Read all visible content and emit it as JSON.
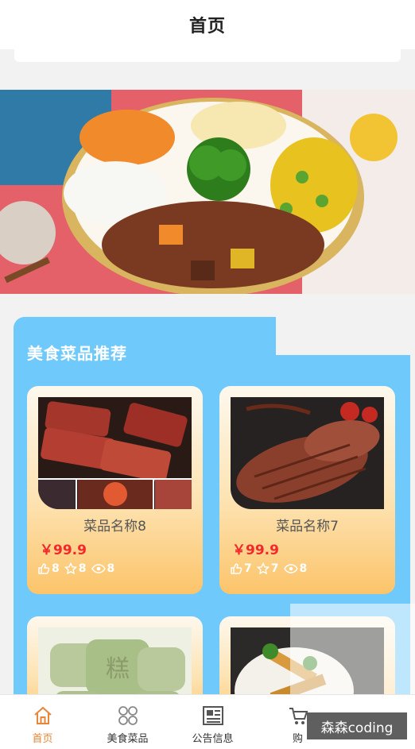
{
  "header": {
    "title": "首页"
  },
  "recommend": {
    "title": "美食菜品推荐",
    "items": [
      {
        "name": "菜品名称8",
        "price": "￥99.9",
        "likes": "8",
        "favorites": "8",
        "views": "8"
      },
      {
        "name": "菜品名称7",
        "price": "￥99.9",
        "likes": "7",
        "favorites": "7",
        "views": "8"
      }
    ]
  },
  "tabbar": {
    "items": [
      {
        "label": "首页",
        "icon": "home-icon",
        "active": true
      },
      {
        "label": "美食菜品",
        "icon": "grid-icon"
      },
      {
        "label": "公告信息",
        "icon": "news-icon"
      },
      {
        "label": "购",
        "icon": "cart-icon"
      }
    ]
  },
  "watermark": "森森coding",
  "colors": {
    "accent": "#e8863a",
    "section_bg": "#70c9fb",
    "price": "#f3282a"
  }
}
